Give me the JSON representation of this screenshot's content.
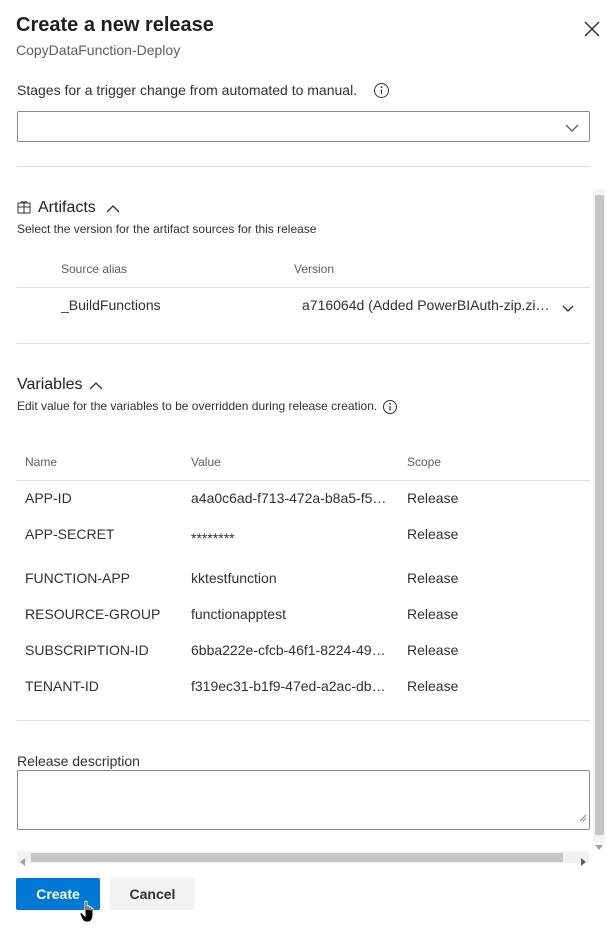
{
  "header": {
    "title": "Create a new release",
    "subtitle": "CopyDataFunction-Deploy"
  },
  "stages": {
    "label": "Stages for a trigger change from automated to manual.",
    "selected": ""
  },
  "artifacts": {
    "title": "Artifacts",
    "description": "Select the version for the artifact sources for this release",
    "col_source": "Source alias",
    "col_version": "Version",
    "rows": [
      {
        "source": "_BuildFunctions",
        "version": "a716064d (Added PowerBIAuth-zip.zip…"
      }
    ]
  },
  "variables": {
    "title": "Variables",
    "description": "Edit value for the variables to be overridden during release creation.",
    "col_name": "Name",
    "col_value": "Value",
    "col_scope": "Scope",
    "rows": [
      {
        "name": "APP-ID",
        "value": "a4a0c6ad-f713-472a-b8a5-f50…",
        "scope": "Release"
      },
      {
        "name": "APP-SECRET",
        "value": "********",
        "scope": "Release"
      },
      {
        "name": "FUNCTION-APP",
        "value": "kktestfunction",
        "scope": "Release"
      },
      {
        "name": "RESOURCE-GROUP",
        "value": "functionapptest",
        "scope": "Release"
      },
      {
        "name": "SUBSCRIPTION-ID",
        "value": "6bba222e-cfcb-46f1-8224-49c…",
        "scope": "Release"
      },
      {
        "name": "TENANT-ID",
        "value": "f319ec31-b1f9-47ed-a2ac-dbc…",
        "scope": "Release"
      }
    ]
  },
  "release_description": {
    "label": "Release description",
    "value": ""
  },
  "buttons": {
    "create": "Create",
    "cancel": "Cancel"
  },
  "colors": {
    "primary": "#0078d4",
    "text": "#201f1e",
    "muted": "#605e5c",
    "border": "#8a8886"
  }
}
